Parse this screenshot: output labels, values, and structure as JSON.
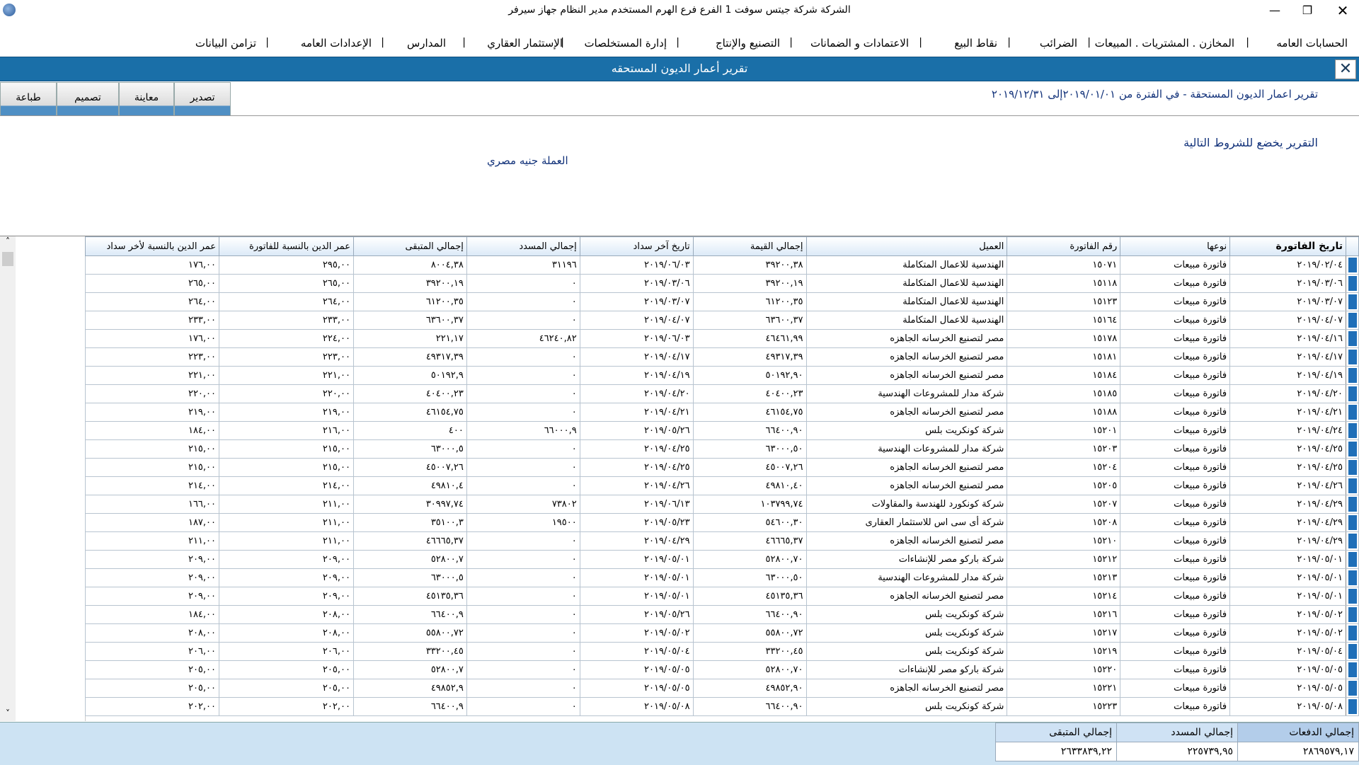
{
  "window": {
    "title": "الشركة شركة جيتس سوفت 1   الفرع فرع الهرم   المستخدم مدير النظام  جهاز سيرفر",
    "minimize": "—",
    "maximize": "❐",
    "close": "✕"
  },
  "menu": [
    "الحسابات العامه",
    "المخازن . المشتريات . المبيعات",
    "الضرائب",
    "نقاط البيع",
    "الاعتمادات و الضمانات",
    "التصنيع والإنتاج",
    "إدارة المستخلصات",
    "الإستثمار العقاري",
    "المدارس",
    "الإعدادات العامه",
    "تزامن البيانات"
  ],
  "menu_separator": "|",
  "report": {
    "title": "تقرير أعمار الديون المستحقه",
    "close": "✕",
    "period": "تقرير اعمار الديون المستحقة -   في الفترة من ٢٠١٩/٠١/٠١إلى ٢٠١٩/١٢/٣١",
    "conditions": "التقرير يخضع للشروط التالية",
    "currency": "العملة جنيه مصري"
  },
  "buttons": {
    "export": "تصدير",
    "preview": "معاينة",
    "design": "تصميم",
    "print": "طباعة"
  },
  "grid": {
    "columns": [
      "تاريخ الفاتورة",
      "نوعها",
      "رقم الفاتورة",
      "العميل",
      "إجمالي القيمة",
      "تاريخ آخر سداد",
      "إجمالي المسدد",
      "إجمالي المتبقى",
      "عمر الدين بالنسبة للفاتورة",
      "عمر الدين بالنسبة لأخر سداد"
    ],
    "rows": [
      [
        "٢٠١٩/٠٢/٠٤",
        "فاتورة مبيعات",
        "١٥٠٧١",
        "الهندسية للاعمال المتكاملة",
        "٣٩٢٠٠,٣٨",
        "٢٠١٩/٠٦/٠٣",
        "٣١١٩٦",
        "٨٠٠٤,٣٨",
        "٢٩٥,٠٠",
        "١٧٦,٠٠"
      ],
      [
        "٢٠١٩/٠٣/٠٦",
        "فاتورة مبيعات",
        "١٥١١٨",
        "الهندسية للاعمال المتكاملة",
        "٣٩٢٠٠,١٩",
        "٢٠١٩/٠٣/٠٦",
        "٠",
        "٣٩٢٠٠,١٩",
        "٢٦٥,٠٠",
        "٢٦٥,٠٠"
      ],
      [
        "٢٠١٩/٠٣/٠٧",
        "فاتورة مبيعات",
        "١٥١٢٣",
        "الهندسية للاعمال المتكاملة",
        "٦١٢٠٠,٣٥",
        "٢٠١٩/٠٣/٠٧",
        "٠",
        "٦١٢٠٠,٣٥",
        "٢٦٤,٠٠",
        "٢٦٤,٠٠"
      ],
      [
        "٢٠١٩/٠٤/٠٧",
        "فاتورة مبيعات",
        "١٥١٦٤",
        "الهندسية للاعمال المتكاملة",
        "٦٣٦٠٠,٣٧",
        "٢٠١٩/٠٤/٠٧",
        "٠",
        "٦٣٦٠٠,٣٧",
        "٢٣٣,٠٠",
        "٢٣٣,٠٠"
      ],
      [
        "٢٠١٩/٠٤/١٦",
        "فاتورة مبيعات",
        "١٥١٧٨",
        "مصر لتصنيع الخرسانه الجاهزه",
        "٤٦٤٦١,٩٩",
        "٢٠١٩/٠٦/٠٣",
        "٤٦٢٤٠,٨٢",
        "٢٢١,١٧",
        "٢٢٤,٠٠",
        "١٧٦,٠٠"
      ],
      [
        "٢٠١٩/٠٤/١٧",
        "فاتورة مبيعات",
        "١٥١٨١",
        "مصر لتصنيع الخرسانه الجاهزه",
        "٤٩٣١٧,٣٩",
        "٢٠١٩/٠٤/١٧",
        "٠",
        "٤٩٣١٧,٣٩",
        "٢٢٣,٠٠",
        "٢٢٣,٠٠"
      ],
      [
        "٢٠١٩/٠٤/١٩",
        "فاتورة مبيعات",
        "١٥١٨٤",
        "مصر لتصنيع الخرسانه الجاهزه",
        "٥٠١٩٢,٩٠",
        "٢٠١٩/٠٤/١٩",
        "٠",
        "٥٠١٩٢,٩",
        "٢٢١,٠٠",
        "٢٢١,٠٠"
      ],
      [
        "٢٠١٩/٠٤/٢٠",
        "فاتورة مبيعات",
        "١٥١٨٥",
        "شركة مدار للمشروعات الهندسية",
        "٤٠٤٠٠,٢٣",
        "٢٠١٩/٠٤/٢٠",
        "٠",
        "٤٠٤٠٠,٢٣",
        "٢٢٠,٠٠",
        "٢٢٠,٠٠"
      ],
      [
        "٢٠١٩/٠٤/٢١",
        "فاتورة مبيعات",
        "١٥١٨٨",
        "مصر لتصنيع الخرسانه الجاهزه",
        "٤٦١٥٤,٧٥",
        "٢٠١٩/٠٤/٢١",
        "٠",
        "٤٦١٥٤,٧٥",
        "٢١٩,٠٠",
        "٢١٩,٠٠"
      ],
      [
        "٢٠١٩/٠٤/٢٤",
        "فاتورة مبيعات",
        "١٥٢٠١",
        "شركة كونكريت بلس",
        "٦٦٤٠٠,٩٠",
        "٢٠١٩/٠٥/٢٦",
        "٦٦٠٠٠,٩",
        "٤٠٠",
        "٢١٦,٠٠",
        "١٨٤,٠٠"
      ],
      [
        "٢٠١٩/٠٤/٢٥",
        "فاتورة مبيعات",
        "١٥٢٠٣",
        "شركة مدار للمشروعات الهندسية",
        "٦٣٠٠٠,٥٠",
        "٢٠١٩/٠٤/٢٥",
        "٠",
        "٦٣٠٠٠,٥",
        "٢١٥,٠٠",
        "٢١٥,٠٠"
      ],
      [
        "٢٠١٩/٠٤/٢٥",
        "فاتورة مبيعات",
        "١٥٢٠٤",
        "مصر لتصنيع الخرسانه الجاهزه",
        "٤٥٠٠٧,٢٦",
        "٢٠١٩/٠٤/٢٥",
        "٠",
        "٤٥٠٠٧,٢٦",
        "٢١٥,٠٠",
        "٢١٥,٠٠"
      ],
      [
        "٢٠١٩/٠٤/٢٦",
        "فاتورة مبيعات",
        "١٥٢٠٥",
        "مصر لتصنيع الخرسانه الجاهزه",
        "٤٩٨١٠,٤٠",
        "٢٠١٩/٠٤/٢٦",
        "٠",
        "٤٩٨١٠,٤",
        "٢١٤,٠٠",
        "٢١٤,٠٠"
      ],
      [
        "٢٠١٩/٠٤/٢٩",
        "فاتورة مبيعات",
        "١٥٢٠٧",
        "شركة كونكورد للهندسة والمقاولات",
        "١٠٣٧٩٩,٧٤",
        "٢٠١٩/٠٦/١٣",
        "٧٣٨٠٢",
        "٣٠٩٩٧,٧٤",
        "٢١١,٠٠",
        "١٦٦,٠٠"
      ],
      [
        "٢٠١٩/٠٤/٢٩",
        "فاتورة مبيعات",
        "١٥٢٠٨",
        "شركة أى سى اس للاستثمار العقارى",
        "٥٤٦٠٠,٣٠",
        "٢٠١٩/٠٥/٢٣",
        "١٩٥٠٠",
        "٣٥١٠٠,٣",
        "٢١١,٠٠",
        "١٨٧,٠٠"
      ],
      [
        "٢٠١٩/٠٤/٢٩",
        "فاتورة مبيعات",
        "١٥٢١٠",
        "مصر لتصنيع الخرسانه الجاهزه",
        "٤٦٦٦٥,٣٧",
        "٢٠١٩/٠٤/٢٩",
        "٠",
        "٤٦٦٦٥,٣٧",
        "٢١١,٠٠",
        "٢١١,٠٠"
      ],
      [
        "٢٠١٩/٠٥/٠١",
        "فاتورة مبيعات",
        "١٥٢١٢",
        "شركة باركو مصر للإنشاءات",
        "٥٢٨٠٠,٧٠",
        "٢٠١٩/٠٥/٠١",
        "٠",
        "٥٢٨٠٠,٧",
        "٢٠٩,٠٠",
        "٢٠٩,٠٠"
      ],
      [
        "٢٠١٩/٠٥/٠١",
        "فاتورة مبيعات",
        "١٥٢١٣",
        "شركة مدار للمشروعات الهندسية",
        "٦٣٠٠٠,٥٠",
        "٢٠١٩/٠٥/٠١",
        "٠",
        "٦٣٠٠٠,٥",
        "٢٠٩,٠٠",
        "٢٠٩,٠٠"
      ],
      [
        "٢٠١٩/٠٥/٠١",
        "فاتورة مبيعات",
        "١٥٢١٤",
        "مصر لتصنيع الخرسانه الجاهزه",
        "٤٥١٣٥,٣٦",
        "٢٠١٩/٠٥/٠١",
        "٠",
        "٤٥١٣٥,٣٦",
        "٢٠٩,٠٠",
        "٢٠٩,٠٠"
      ],
      [
        "٢٠١٩/٠٥/٠٢",
        "فاتورة مبيعات",
        "١٥٢١٦",
        "شركة كونكريت بلس",
        "٦٦٤٠٠,٩٠",
        "٢٠١٩/٠٥/٢٦",
        "٠",
        "٦٦٤٠٠,٩",
        "٢٠٨,٠٠",
        "١٨٤,٠٠"
      ],
      [
        "٢٠١٩/٠٥/٠٢",
        "فاتورة مبيعات",
        "١٥٢١٧",
        "شركة كونكريت بلس",
        "٥٥٨٠٠,٧٢",
        "٢٠١٩/٠٥/٠٢",
        "٠",
        "٥٥٨٠٠,٧٢",
        "٢٠٨,٠٠",
        "٢٠٨,٠٠"
      ],
      [
        "٢٠١٩/٠٥/٠٤",
        "فاتورة مبيعات",
        "١٥٢١٩",
        "شركة كونكريت بلس",
        "٣٣٢٠٠,٤٥",
        "٢٠١٩/٠٥/٠٤",
        "٠",
        "٣٣٢٠٠,٤٥",
        "٢٠٦,٠٠",
        "٢٠٦,٠٠"
      ],
      [
        "٢٠١٩/٠٥/٠٥",
        "فاتورة مبيعات",
        "١٥٢٢٠",
        "شركة باركو مصر للإنشاءات",
        "٥٢٨٠٠,٧٠",
        "٢٠١٩/٠٥/٠٥",
        "٠",
        "٥٢٨٠٠,٧",
        "٢٠٥,٠٠",
        "٢٠٥,٠٠"
      ],
      [
        "٢٠١٩/٠٥/٠٥",
        "فاتورة مبيعات",
        "١٥٢٢١",
        "مصر لتصنيع الخرسانه الجاهزه",
        "٤٩٨٥٢,٩٠",
        "٢٠١٩/٠٥/٠٥",
        "٠",
        "٤٩٨٥٢,٩",
        "٢٠٥,٠٠",
        "٢٠٥,٠٠"
      ],
      [
        "٢٠١٩/٠٥/٠٨",
        "فاتورة مبيعات",
        "١٥٢٢٣",
        "شركة كونكريت بلس",
        "٦٦٤٠٠,٩٠",
        "٢٠١٩/٠٥/٠٨",
        "٠",
        "٦٦٤٠٠,٩",
        "٢٠٢,٠٠",
        "٢٠٢,٠٠"
      ]
    ]
  },
  "totals": {
    "payments_label": "إجمالي الدفعات",
    "paid_label": "إجمالي المسدد",
    "remaining_label": "إجمالي المتبقى",
    "payments": "٢٨٦٩٥٧٩,١٧",
    "paid": "٢٢٥٧٣٩,٩٥",
    "remaining": "٢٦٣٣٨٣٩,٢٢"
  },
  "scroll": {
    "up": "˄",
    "down": "˅"
  }
}
